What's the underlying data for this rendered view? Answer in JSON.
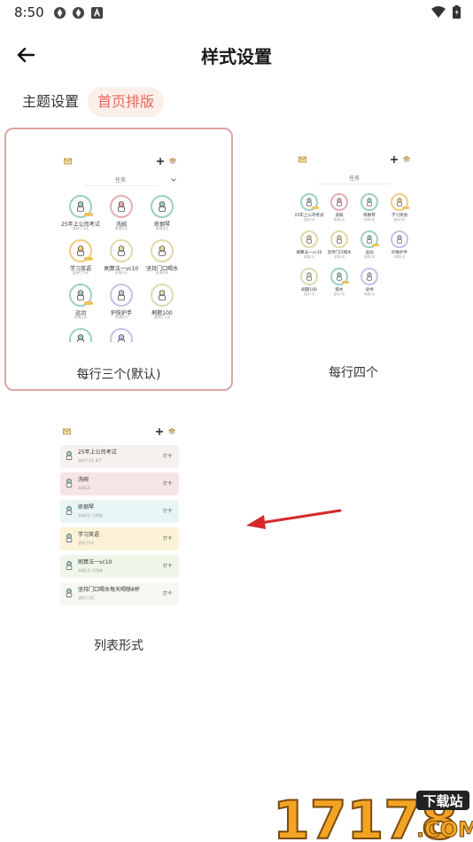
{
  "status": {
    "time": "8:50"
  },
  "header": {
    "title": "样式设置"
  },
  "tabs": [
    {
      "label": "主题设置"
    },
    {
      "label": "首页排版"
    }
  ],
  "layouts": [
    {
      "label": "每行三个(默认)",
      "selected": true
    },
    {
      "label": "每行四个",
      "selected": false
    },
    {
      "label": "列表形式",
      "selected": false
    }
  ],
  "preview_common": {
    "selector": "任务",
    "punch_label": "打卡"
  },
  "grid3": {
    "habits": [
      {
        "name": "25年上公司考试",
        "sub": "坚持了3天",
        "color": "#9ecfc4"
      },
      {
        "name": "洗碗",
        "sub": "本周1天",
        "color": "#e7aeb0"
      },
      {
        "name": "练钢琴",
        "sub": "本周3天",
        "color": "#9ecfc4"
      },
      {
        "name": "学习英语",
        "sub": "坚持了5天",
        "color": "#f1cc7e"
      },
      {
        "name": "刷算法一vc10",
        "sub": "本周1天",
        "color": "#e2d9a8"
      },
      {
        "name": "坚持门口喝水",
        "sub": "本周3天",
        "color": "#e2d9a8"
      },
      {
        "name": "运动",
        "sub": "本周1天",
        "color": "#9ecfc4"
      },
      {
        "name": "护肤护手",
        "sub": "本周1天",
        "color": "#c9c0e6"
      },
      {
        "name": "刷题100",
        "sub": "坚持了1天",
        "color": "#d4e0b0"
      },
      {
        "name": "",
        "sub": "",
        "color": "#9ecfc4"
      },
      {
        "name": "",
        "sub": "",
        "color": "#c9c0e6"
      }
    ]
  },
  "grid4": {
    "habits": [
      {
        "name": "25年上公司考试",
        "sub": "坚持7天",
        "color": "#9ecfc4"
      },
      {
        "name": "洗碗",
        "sub": "本周1天",
        "color": "#e7aeb0"
      },
      {
        "name": "练钢琴",
        "sub": "本周3天",
        "color": "#9ecfc4"
      },
      {
        "name": "学习英语",
        "sub": "坚持5天",
        "color": "#f1cc7e"
      },
      {
        "name": "刷算法一vc10",
        "sub": "本周1天",
        "color": "#e2d9a8"
      },
      {
        "name": "坚持门口喝水",
        "sub": "本周3天",
        "color": "#e2d9a8"
      },
      {
        "name": "运动",
        "sub": "本周1天",
        "color": "#9ecfc4"
      },
      {
        "name": "护肤护手",
        "sub": "本周1天",
        "color": "#c9c0e6"
      },
      {
        "name": "刷题100",
        "sub": "坚持1天",
        "color": "#d4e0b0"
      },
      {
        "name": "喝水",
        "sub": "坚持7天",
        "color": "#9ecfc4"
      },
      {
        "name": "读书",
        "sub": "本周1天",
        "color": "#c9c0e6"
      }
    ]
  },
  "list": {
    "rows": [
      {
        "name": "25年上公司考试",
        "sub": "坚持了3天    8/7",
        "bg": "#f6f1ee"
      },
      {
        "name": "洗碗",
        "sub": "本周1天",
        "bg": "#f6e5e5"
      },
      {
        "name": "练钢琴",
        "sub": "本周3天    已完成",
        "bg": "#e7f6f5"
      },
      {
        "name": "学习英语",
        "sub": "坚持了5天",
        "bg": "#fbf2d8"
      },
      {
        "name": "刷算法一vc10",
        "sub": "本周1天    已完成",
        "bg": "#eef6ea"
      },
      {
        "name": "坚持门口喝水每天喝够8杯",
        "sub": "坚持了3天",
        "bg": "#f6f7f3"
      }
    ]
  },
  "watermark": {
    "text": "17178",
    "badge": "下载站",
    "domain": ".COM"
  }
}
